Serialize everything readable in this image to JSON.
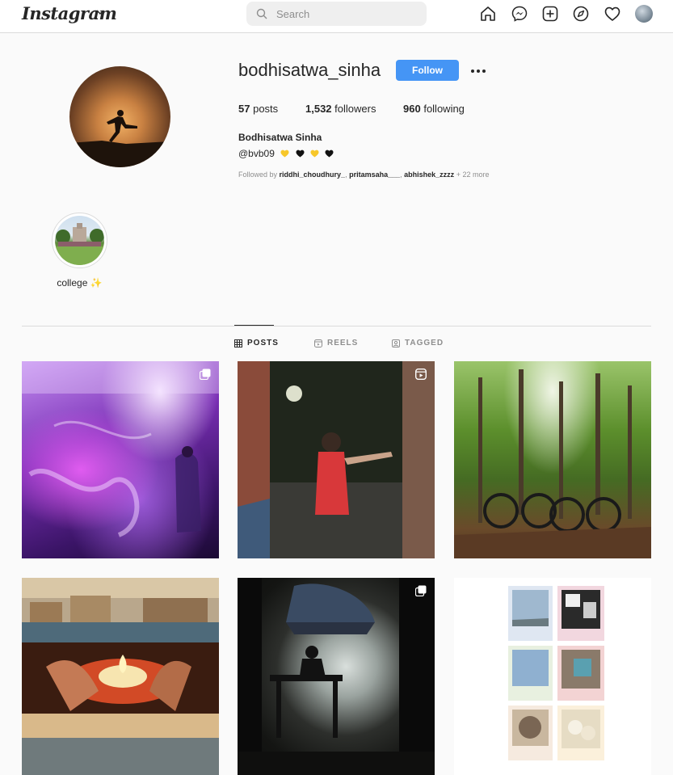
{
  "nav": {
    "logo": "Instagram",
    "search_placeholder": "Search",
    "icons": [
      "home-icon",
      "messenger-icon",
      "new-post-icon",
      "explore-icon",
      "activity-heart-icon",
      "profile-avatar"
    ]
  },
  "profile": {
    "username": "bodhisatwa_sinha",
    "follow_label": "Follow",
    "posts_count": "57",
    "posts_label": "posts",
    "followers_count": "1,532",
    "followers_label": "followers",
    "following_count": "960",
    "following_label": "following",
    "full_name": "Bodhisatwa Sinha",
    "bio_handle": "@bvb09",
    "bio_emojis": [
      "yellow-heart",
      "black-heart",
      "yellow-heart",
      "black-heart"
    ],
    "followed_by_prefix": "Followed by",
    "followed_by_users": [
      "riddhi_choudhury_",
      "pritamsaha___",
      "abhishek_zzzz"
    ],
    "followed_by_more": "+ 22 more"
  },
  "highlights": [
    {
      "label": "college ✨"
    }
  ],
  "tabs": [
    {
      "label": "POSTS",
      "active": true
    },
    {
      "label": "REELS",
      "active": false
    },
    {
      "label": "TAGGED",
      "active": false
    }
  ],
  "posts": [
    {
      "type": "carousel",
      "subject": "concert stage purple lights"
    },
    {
      "type": "reel",
      "subject": "night street celebration"
    },
    {
      "type": "image",
      "subject": "bicycles in forest"
    },
    {
      "type": "image",
      "subject": "ghats and diya collage"
    },
    {
      "type": "carousel",
      "subject": "silhouette by window river"
    },
    {
      "type": "image",
      "subject": "polaroid collage"
    }
  ],
  "colors": {
    "accent": "#4595f5",
    "text": "#262626",
    "muted": "#8e8e8e",
    "border": "#dbdbdb",
    "background": "#fafafa"
  }
}
